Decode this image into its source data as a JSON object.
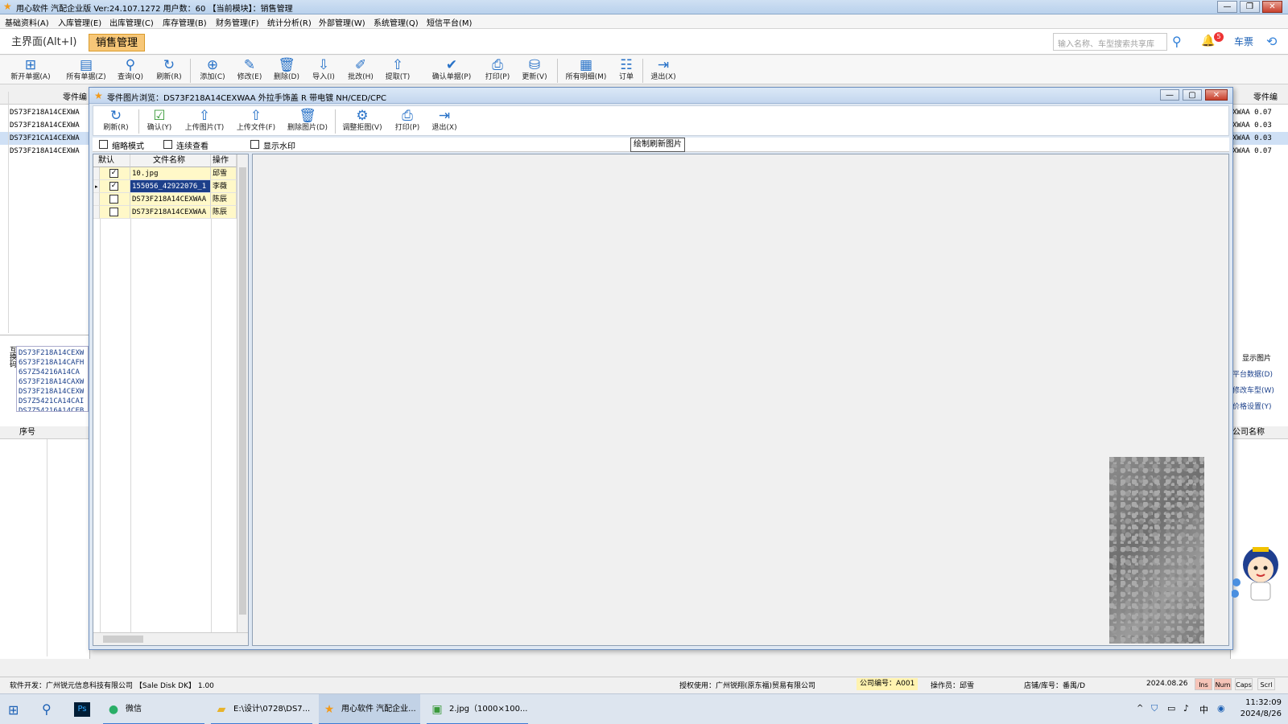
{
  "app": {
    "title": "用心软件 汽配企业版  Ver:24.107.1272  用户数：60 【当前模块】：销售管理"
  },
  "menu": [
    "基础资料(A)",
    "入库管理(E)",
    "出库管理(C)",
    "库存管理(B)",
    "财务管理(F)",
    "统计分析(R)",
    "外部管理(W)",
    "系统管理(Q)",
    "短信平台(M)"
  ],
  "module_tabs": {
    "home": "主界面(Alt+I)",
    "active": "销售管理"
  },
  "search": {
    "placeholder": "输入名称、车型搜索共享库"
  },
  "notifications": {
    "count": "5"
  },
  "cart_label": "车票",
  "main_toolbar": [
    {
      "label": "新开单据(A)",
      "icon": "new-doc-icon"
    },
    {
      "label": "所有单据(Z)",
      "icon": "all-docs-icon"
    },
    {
      "label": "查询(Q)",
      "icon": "search-icon"
    },
    {
      "label": "刷新(R)",
      "icon": "refresh-icon"
    },
    {
      "label": "添加(C)",
      "icon": "add-icon"
    },
    {
      "label": "修改(E)",
      "icon": "edit-icon"
    },
    {
      "label": "删除(D)",
      "icon": "delete-icon"
    },
    {
      "label": "导入(I)",
      "icon": "import-icon"
    },
    {
      "label": "批改(H)",
      "icon": "batch-edit-icon"
    },
    {
      "label": "提取(T)",
      "icon": "extract-icon"
    },
    {
      "label": "确认单据(P)",
      "icon": "confirm-icon"
    },
    {
      "label": "打印(P)",
      "icon": "print-icon"
    },
    {
      "label": "更新(V)",
      "icon": "update-icon"
    },
    {
      "label": "所有明细(M)",
      "icon": "details-icon"
    },
    {
      "label": "订单",
      "icon": "order-icon"
    },
    {
      "label": "退出(X)",
      "icon": "exit-icon"
    }
  ],
  "background": {
    "left_header": "零件编",
    "left_rows": [
      "DS73F218A14CEXWA",
      "DS73F218A14CEXWA",
      "DS73F21CA14CEXWA",
      "DS73F218A14CEXWA"
    ],
    "left_lower_rows": [
      "DS73F218A14CEXW",
      "6S73F218A14CAFH",
      "6S7Z54216A14CA",
      "6S73F218A14CAXW",
      "DS73F218A14CEXW",
      "DS7Z5421CA14CAI",
      "DS7Z54216A14CEB"
    ],
    "left_side_label": "互换码",
    "seq_header": "序号",
    "right_header": "零件编",
    "right_rows": [
      "XWAA 0.07",
      "XWAA 0.03",
      "XWAA 0.03",
      "XWAA 0.07"
    ],
    "right_links": [
      "显示图片",
      "平台数据(D)",
      "修改车型(W)",
      "价格设置(Y)"
    ],
    "right_lower_header": "公司名称"
  },
  "dialog": {
    "title": "零件图片浏览：DS73F218A14CEXWAA 外拉手饰盖 R 带电镀 NH/CED/CPC",
    "toolbar": [
      {
        "label": "刷新(R)",
        "icon": "refresh-icon"
      },
      {
        "label": "确认(Y)",
        "icon": "confirm-icon"
      },
      {
        "label": "上传图片(T)",
        "icon": "upload-image-icon"
      },
      {
        "label": "上传文件(F)",
        "icon": "upload-file-icon"
      },
      {
        "label": "删除图片(D)",
        "icon": "delete-image-icon"
      },
      {
        "label": "调整拒图(V)",
        "icon": "settings-icon"
      },
      {
        "label": "打印(P)",
        "icon": "print-icon"
      },
      {
        "label": "退出(X)",
        "icon": "exit-icon"
      }
    ],
    "options": {
      "thumbnail_mode": "缩略模式",
      "continuous_view": "连续查看",
      "show_watermark": "显示水印",
      "watermark_button": "绘制刷新图片"
    },
    "grid": {
      "headers": [
        "默认",
        "文件名称",
        "操作"
      ],
      "rows": [
        {
          "checked": true,
          "name": "10.jpg",
          "op": "邱雪"
        },
        {
          "checked": true,
          "name": "155056_42922076_1",
          "op": "李薇",
          "selected": true
        },
        {
          "checked": false,
          "name": "DS73F218A14CEXWAA",
          "op": "陈辰"
        },
        {
          "checked": false,
          "name": "DS73F218A14CEXWAA",
          "op": "陈辰"
        }
      ]
    }
  },
  "status": {
    "developer": "软件开发：广州锐元信息科技有限公司 【Sale Disk DK】 1.00",
    "licensee": "授权使用：广州锐翔(原东福)贸易有限公司",
    "company_code": "公司编号：A001",
    "operator": "操作员：邱雪",
    "shop": "店铺/库号：番禺/D",
    "date": "2024.08.26",
    "indicators": [
      "Ins",
      "Num",
      "Caps",
      "Scrl"
    ]
  },
  "taskbar": {
    "items": [
      {
        "label": "微信",
        "icon": "wechat-icon"
      },
      {
        "label": "E:\\设计\\0728\\DS7...",
        "icon": "folder-icon"
      },
      {
        "label": "用心软件 汽配企业...",
        "icon": "app-icon",
        "active": true
      },
      {
        "label": "2.jpg（1000×100...",
        "icon": "image-viewer-icon"
      }
    ],
    "time": "11:32:09",
    "date": "2024/8/26"
  },
  "colors": {
    "accent": "#2872c8",
    "active_tab": "#f7c778",
    "selection": "#1c3f8a",
    "highlight_cell": "#fff8c8"
  }
}
